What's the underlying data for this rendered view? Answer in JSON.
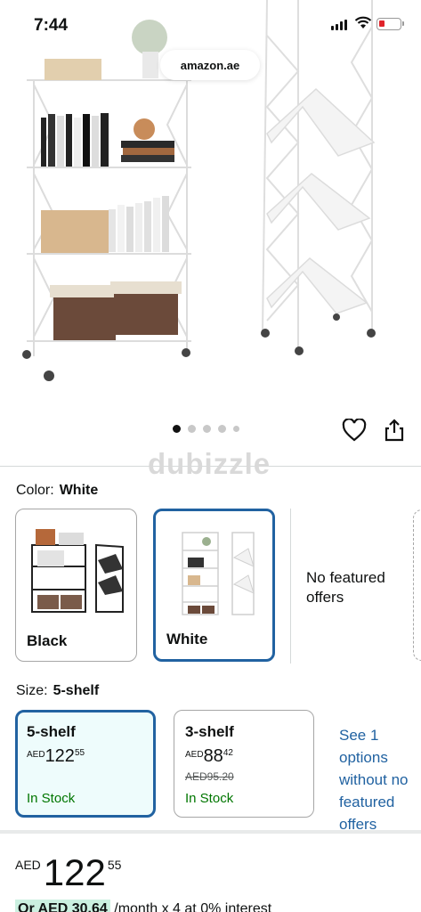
{
  "status_bar": {
    "time": "7:44"
  },
  "browser": {
    "url": "amazon.ae"
  },
  "gallery": {
    "total_images": 5,
    "active_index": 0
  },
  "watermark": "dubizzle",
  "color": {
    "label": "Color:",
    "selected": "White",
    "options": [
      {
        "name": "Black"
      },
      {
        "name": "White"
      }
    ],
    "no_featured_offers": "No featured offers"
  },
  "size": {
    "label": "Size:",
    "selected": "5-shelf",
    "options": [
      {
        "name": "5-shelf",
        "currency": "AED",
        "whole": "122",
        "fraction": "55",
        "list_price": "",
        "stock": "In Stock"
      },
      {
        "name": "3-shelf",
        "currency": "AED",
        "whole": "88",
        "fraction": "42",
        "list_price": "AED95.20",
        "stock": "In Stock"
      }
    ],
    "see_options": "See 1 options without no featured offers"
  },
  "price": {
    "currency": "AED",
    "whole": "122",
    "fraction": "55"
  },
  "installment": {
    "highlight": "Or AED 30.64",
    "rest": "/month x 4 at 0% interest"
  },
  "colors": {
    "link": "#2162a1",
    "selected_border": "#2162a1",
    "in_stock": "#007600",
    "selected_bg": "#eefcfc"
  }
}
